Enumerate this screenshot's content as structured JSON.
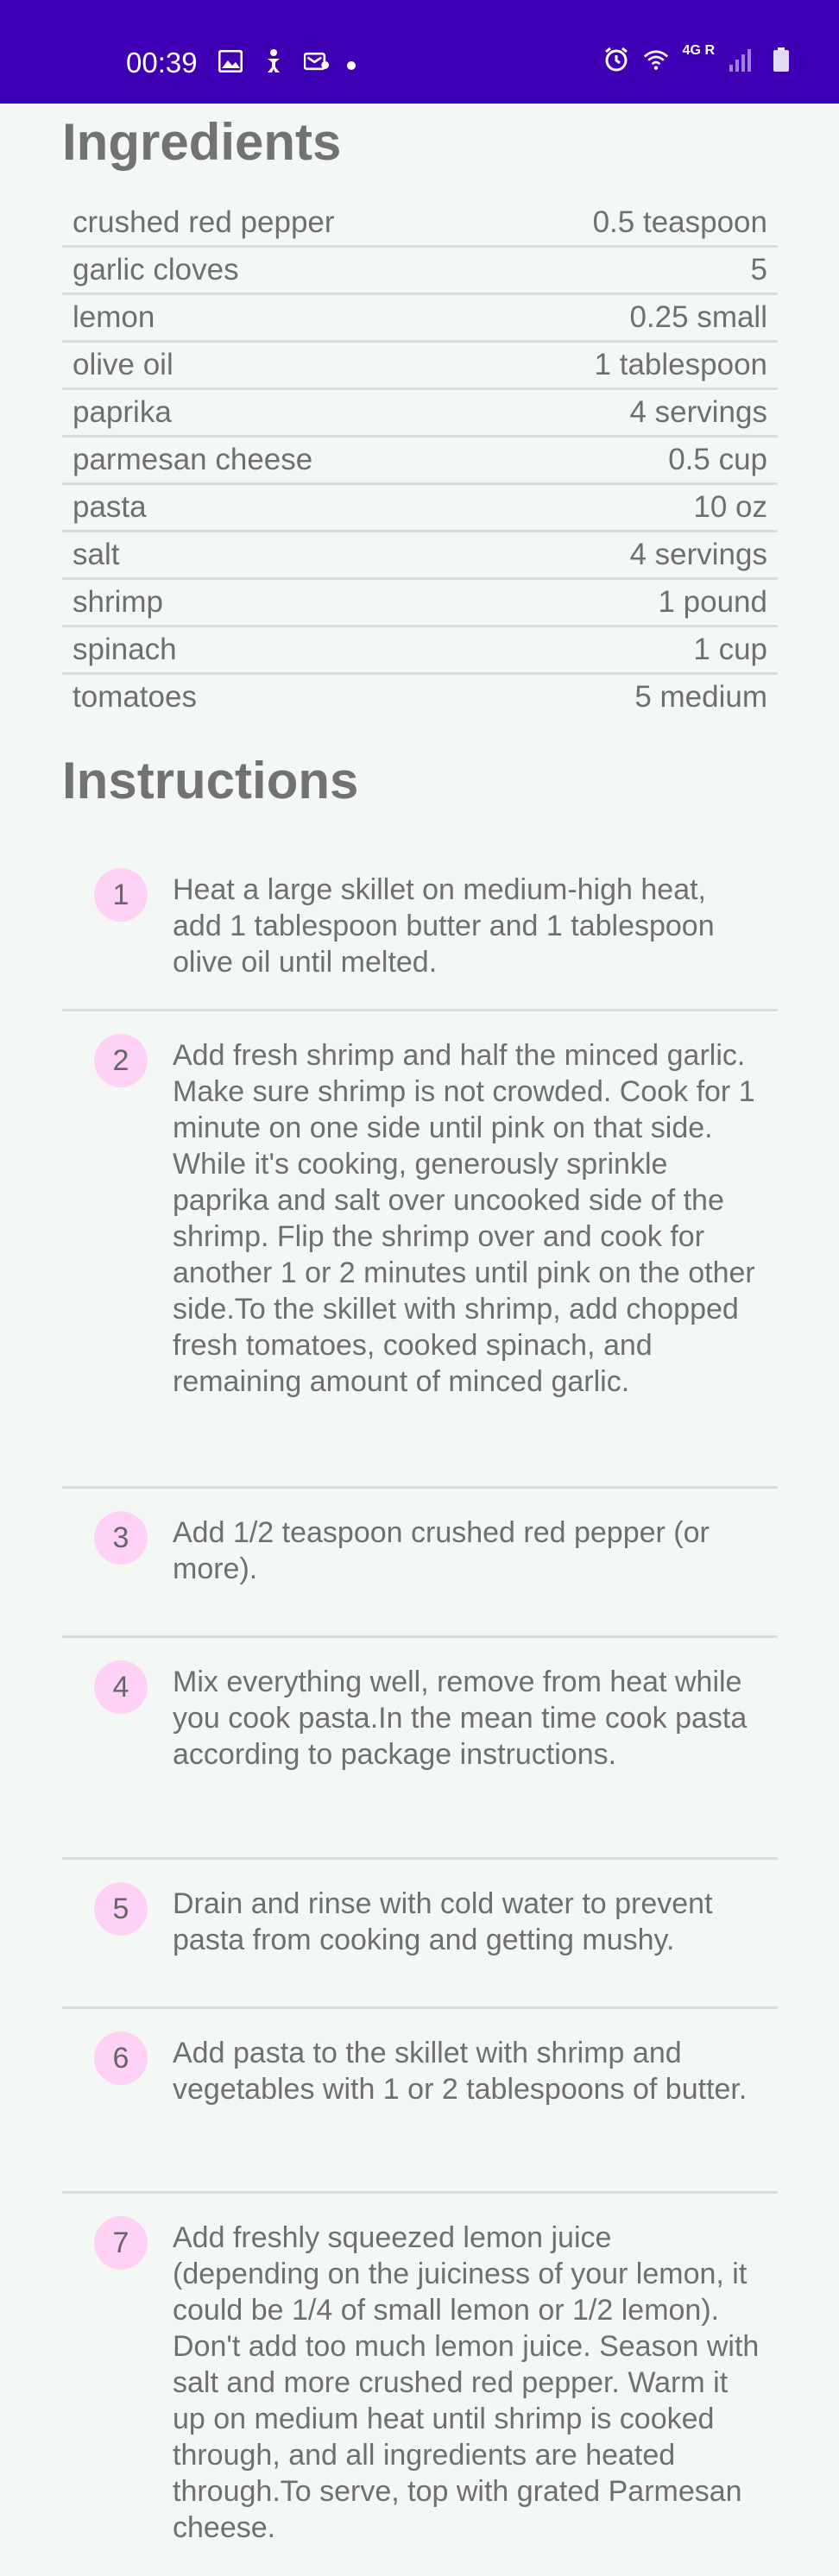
{
  "status_bar": {
    "time": "00:39",
    "left_icons": [
      "image-icon",
      "accessibility-icon",
      "vpn-icon",
      "dot-icon"
    ],
    "right_icons": [
      "alarm-icon",
      "wifi-icon",
      "signal-icon",
      "battery-icon"
    ],
    "network_label": "4G R"
  },
  "ingredients": {
    "title": "Ingredients",
    "items": [
      {
        "name": "crushed red pepper",
        "amount": "0.5 teaspoon"
      },
      {
        "name": "garlic cloves",
        "amount": "5"
      },
      {
        "name": "lemon",
        "amount": "0.25 small"
      },
      {
        "name": "olive oil",
        "amount": "1 tablespoon"
      },
      {
        "name": "paprika",
        "amount": "4 servings"
      },
      {
        "name": "parmesan cheese",
        "amount": "0.5 cup"
      },
      {
        "name": "pasta",
        "amount": "10 oz"
      },
      {
        "name": "salt",
        "amount": "4 servings"
      },
      {
        "name": "shrimp",
        "amount": "1 pound"
      },
      {
        "name": "spinach",
        "amount": "1 cup"
      },
      {
        "name": "tomatoes",
        "amount": "5 medium"
      }
    ]
  },
  "instructions": {
    "title": "Instructions",
    "steps": [
      {
        "num": "1",
        "text": "Heat a large skillet on medium-high heat, add 1 tablespoon butter and 1 tablespoon olive oil until melted."
      },
      {
        "num": "2",
        "text": "Add fresh shrimp and half the minced garlic. Make sure shrimp is not crowded. Cook for 1 minute on one side until pink on that side. While it's cooking, generously sprinkle paprika and salt over uncooked side of the shrimp. Flip the shrimp over and cook for another 1 or 2 minutes until pink on the other side.To the skillet with shrimp, add chopped fresh tomatoes, cooked spinach, and remaining amount of minced garlic."
      },
      {
        "num": "3",
        "text": "Add 1/2 teaspoon crushed red pepper (or more)."
      },
      {
        "num": "4",
        "text": "Mix everything well, remove from heat while you cook pasta.In the mean time cook pasta according to package instructions."
      },
      {
        "num": "5",
        "text": "Drain and rinse with cold water to prevent pasta from cooking and getting mushy."
      },
      {
        "num": "6",
        "text": "Add pasta to the skillet with shrimp and vegetables with 1 or 2 tablespoons of butter."
      },
      {
        "num": "7",
        "text": "Add freshly squeezed lemon juice (depending on the juiciness of your lemon, it could be 1/4 of small lemon or 1/2 lemon). Don't add too much lemon juice. Season with salt and more crushed red pepper. Warm it up on medium heat until shrimp is cooked through, and all ingredients are heated through.To serve, top with grated Parmesan cheese."
      }
    ]
  },
  "colors": {
    "status_bar": "#3f00b5",
    "background": "#f4f8f5",
    "step_badge": "#ffd2f5",
    "divider": "#d8dcd9"
  }
}
